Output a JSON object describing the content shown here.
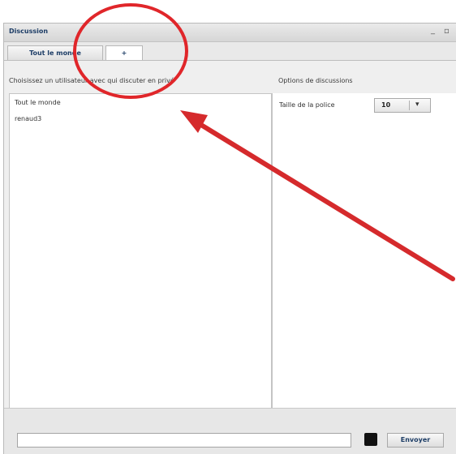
{
  "window": {
    "title": "Discussion",
    "minimize_glyph": "_"
  },
  "tabs": [
    {
      "label": "Tout le monde"
    },
    {
      "label": "+"
    }
  ],
  "left_panel": {
    "label": "Choisissez un utilisateur avec qui discuter en privé",
    "users": [
      "Tout le monde",
      "renaud3"
    ]
  },
  "right_panel": {
    "label": "Options de discussions",
    "font_size_label": "Taille de la police",
    "font_size_value": "10",
    "chevron": "▾"
  },
  "bottom": {
    "message_value": "",
    "send_label": "Envoyer",
    "color_swatch": "#111111"
  },
  "colors": {
    "accent": "#1d3d66",
    "annotation": "#e0262a"
  },
  "icons": {
    "dropdown": "chevron-down-icon",
    "color": "color-swatch-icon"
  }
}
